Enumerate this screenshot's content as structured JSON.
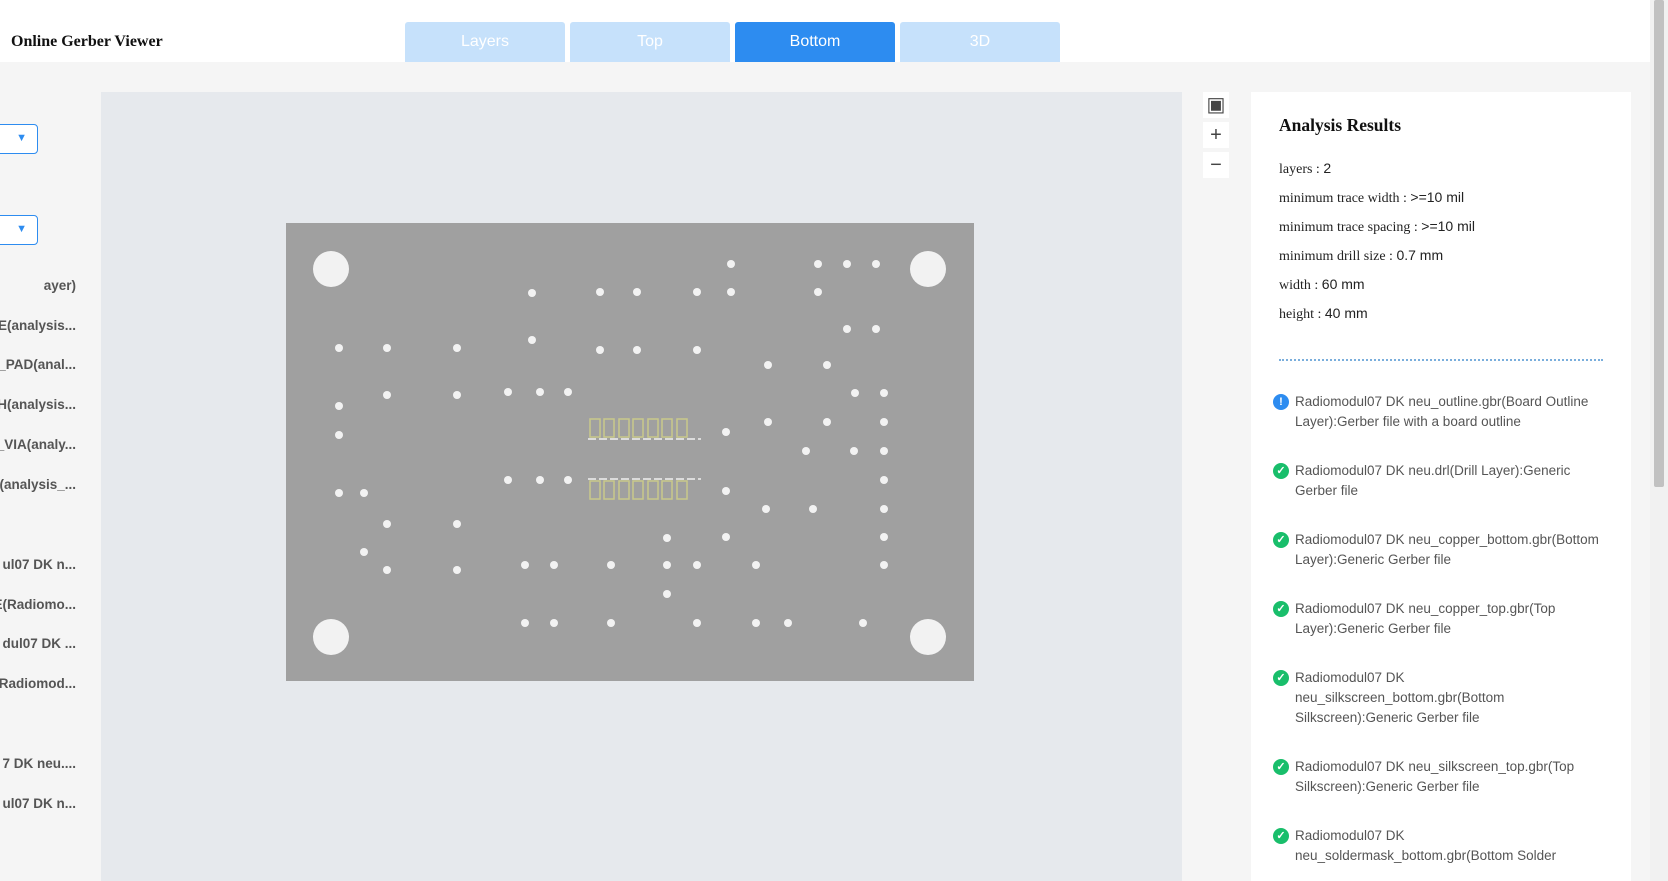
{
  "header": {
    "title": "Online Gerber Viewer",
    "tabs": [
      "Layers",
      "Top",
      "Bottom",
      "3D"
    ],
    "active_tab": "Bottom"
  },
  "left_panel": {
    "items": [
      "ayer)",
      "E(analysis...",
      "_PAD(anal...",
      "H(analysis...",
      "_VIA(analy...",
      "(analysis_...",
      "ul07 DK n...",
      "E(Radiomo...",
      "dul07 DK ...",
      "Radiomod...",
      "7 DK neu....",
      "ul07 DK n..."
    ]
  },
  "analysis": {
    "title": "Analysis Results",
    "properties": [
      {
        "label": "layers : ",
        "value": "2"
      },
      {
        "label": "minimum trace width : ",
        "value": ">=10 mil"
      },
      {
        "label": "minimum trace spacing : ",
        "value": ">=10 mil"
      },
      {
        "label": "minimum drill size : ",
        "value": "0.7 mm"
      },
      {
        "label": "width : ",
        "value": "60 mm"
      },
      {
        "label": "height : ",
        "value": "40 mm"
      }
    ],
    "files": [
      {
        "status": "info",
        "text": "Radiomodul07 DK neu_outline.gbr(Board Outline Layer):Gerber file with a board outline"
      },
      {
        "status": "ok",
        "text": "Radiomodul07 DK neu.drl(Drill Layer):Generic Gerber file"
      },
      {
        "status": "ok",
        "text": "Radiomodul07 DK neu_copper_bottom.gbr(Bottom Layer):Generic Gerber file"
      },
      {
        "status": "ok",
        "text": "Radiomodul07 DK neu_copper_top.gbr(Top Layer):Generic Gerber file"
      },
      {
        "status": "ok",
        "text": "Radiomodul07 DK neu_silkscreen_bottom.gbr(Bottom Silkscreen):Generic Gerber file"
      },
      {
        "status": "ok",
        "text": "Radiomodul07 DK neu_silkscreen_top.gbr(Top Silkscreen):Generic Gerber file"
      },
      {
        "status": "ok",
        "text": "Radiomodul07 DK neu_soldermask_bottom.gbr(Bottom Solder"
      }
    ]
  },
  "colors": {
    "accent": "#2d8cf0",
    "tab_inactive": "#c6e1fb",
    "board": "#a0a0a0",
    "silkscreen": "#c9c98a",
    "success": "#19be6b"
  },
  "icons": {
    "fit": "focus-fit-icon",
    "zoom_in": "plus-icon",
    "zoom_out": "minus-icon",
    "dropdown": "chevron-down-icon",
    "file_ok": "check-circle-icon",
    "file_info": "info-circle-icon"
  }
}
